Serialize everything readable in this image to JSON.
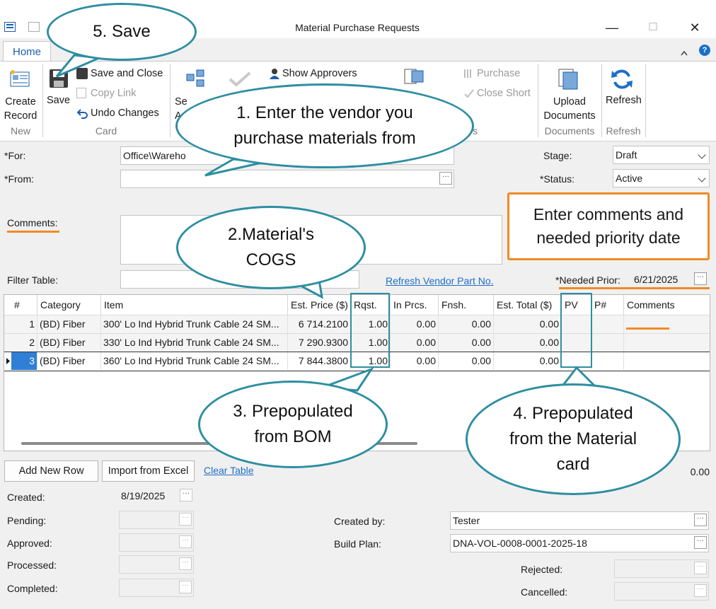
{
  "window": {
    "title": "Material Purchase Requests",
    "minimize": "—",
    "maximize": "☐",
    "close": "✕"
  },
  "tabs": {
    "home": "Home"
  },
  "ribbon": {
    "create_record": [
      "Create",
      "Record"
    ],
    "save": "Save",
    "save_and_close": "Save and Close",
    "copy_link": "Copy Link",
    "undo_changes": "Undo Changes",
    "show_approvers": "Show Approvers",
    "purchase": "Purchase",
    "close_short": "Close Short",
    "upload_documents": [
      "Upload",
      "Documents"
    ],
    "refresh": "Refresh",
    "groups": {
      "new": "New",
      "card": "Card",
      "documents": "Documents",
      "refresh": "Refresh"
    },
    "partial_left": [
      "Se",
      "A"
    ],
    "partial_group": "s"
  },
  "form": {
    "for_label": "*For:",
    "for_value": "Office\\Wareho",
    "from_label": "*From:",
    "from_value": "",
    "stage_label": "Stage:",
    "stage_value": "Draft",
    "status_label": "*Status:",
    "status_value": "Active",
    "comments_label": "Comments:",
    "filter_label": "Filter Table:",
    "refresh_vendor_link": "Refresh Vendor Part No.",
    "needed_prior_label": "*Needed Prior:",
    "needed_prior_value": "6/21/2025"
  },
  "table": {
    "headers": [
      "#",
      "Category",
      "Item",
      "Est. Price ($)",
      "Rqst.",
      "In Prcs.",
      "Fnsh.",
      "Est. Total ($)",
      "PV",
      "P#",
      "Comments"
    ],
    "rows": [
      {
        "n": "1",
        "category": "(BD) Fiber",
        "item": "300' Lo Ind Hybrid Trunk Cable 24 SM...",
        "price": "6 714.2100",
        "rqst": "1.00",
        "inprcs": "0.00",
        "fnsh": "0.00",
        "total": "0.00"
      },
      {
        "n": "2",
        "category": "(BD) Fiber",
        "item": "330' Lo Ind Hybrid Trunk Cable 24 SM...",
        "price": "7 290.9300",
        "rqst": "1.00",
        "inprcs": "0.00",
        "fnsh": "0.00",
        "total": "0.00"
      },
      {
        "n": "3",
        "category": "(BD) Fiber",
        "item": "360' Lo Ind Hybrid Trunk Cable 24 SM...",
        "price": "7 844.3800",
        "rqst": "1.00",
        "inprcs": "0.00",
        "fnsh": "0.00",
        "total": "0.00"
      }
    ],
    "total": "0.00"
  },
  "buttons": {
    "add_new_row": "Add New Row",
    "import_from_excel": "Import from Excel",
    "clear_table": "Clear Table"
  },
  "bottom": {
    "created_label": "Created:",
    "created_value": "8/19/2025",
    "pending_label": "Pending:",
    "approved_label": "Approved:",
    "processed_label": "Processed:",
    "completed_label": "Completed:",
    "created_by_label": "Created by:",
    "created_by_value": "Tester",
    "build_plan_label": "Build Plan:",
    "build_plan_value": "DNA-VOL-0008-0001-2025-18",
    "rejected_label": "Rejected:",
    "cancelled_label": "Cancelled:"
  },
  "callouts": {
    "save": "5. Save",
    "vendor": [
      "1. Enter the vendor you",
      "purchase materials from"
    ],
    "cogs": [
      "2.Material's",
      "COGS"
    ],
    "bom": [
      "3. Prepopulated",
      "from BOM"
    ],
    "material_card": [
      "4. Prepopulated",
      "from the Material",
      "card"
    ],
    "comments_box": [
      "Enter comments and",
      "needed priority date"
    ]
  },
  "colors": {
    "accent_teal": "#2e8ea1",
    "accent_orange": "#f08a24",
    "link_blue": "#1f6fc7"
  }
}
